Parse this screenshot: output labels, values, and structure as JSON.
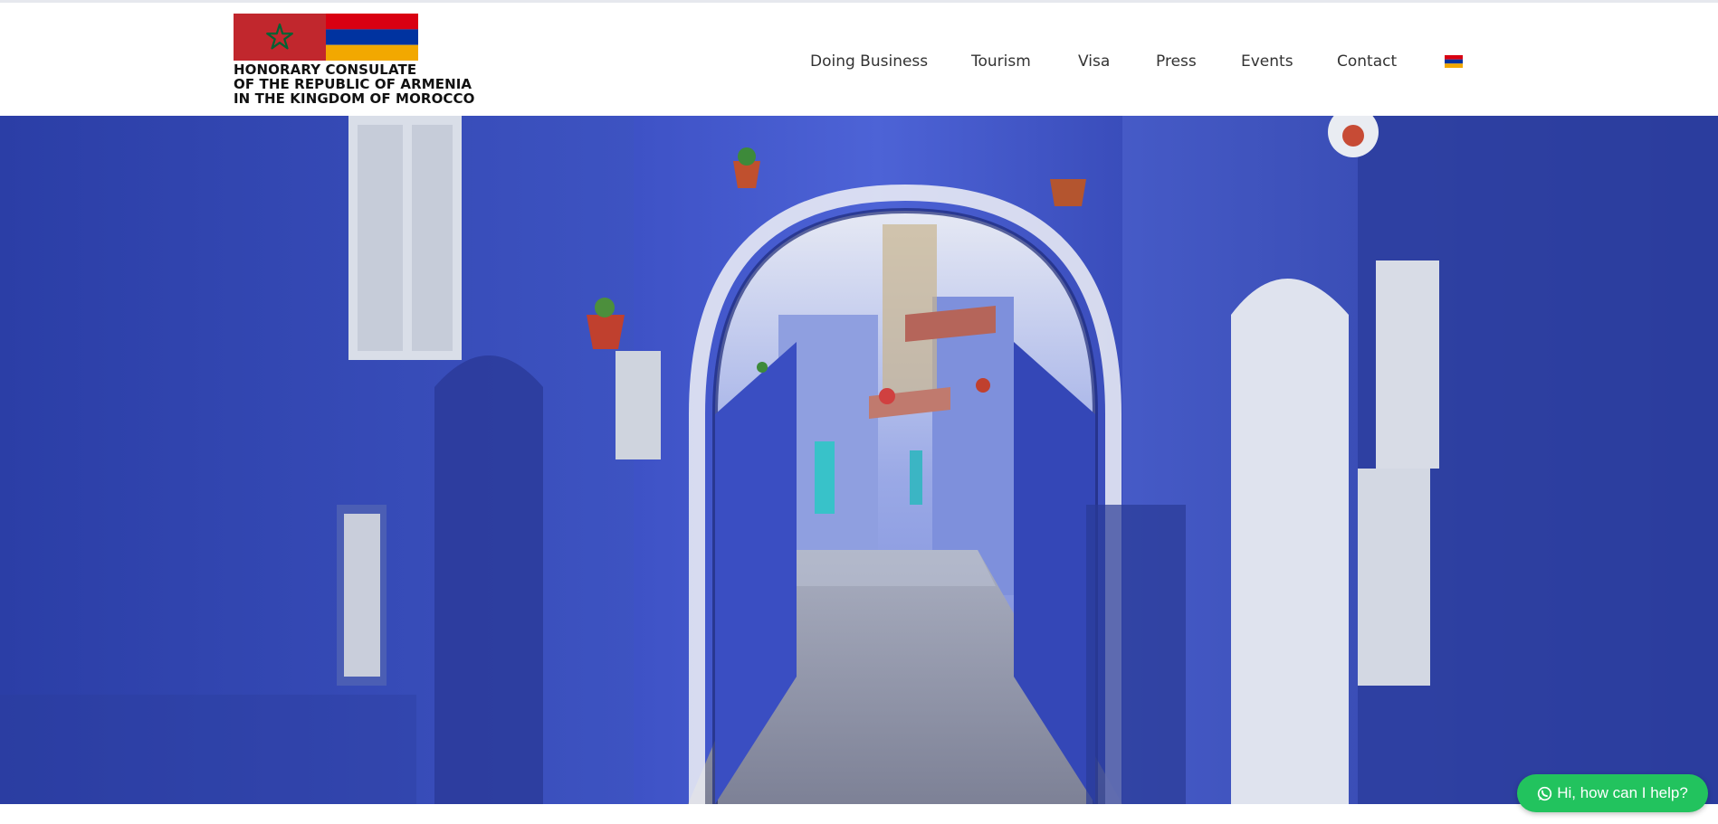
{
  "header": {
    "logo_lines": [
      "HONORARY CONSULATE",
      "OF THE REPUBLIC OF ARMENIA",
      "IN THE KINGDOM OF MOROCCO"
    ],
    "flags": {
      "morocco": {
        "field": "#c1272d",
        "star": "#006233"
      },
      "armenia": {
        "red": "#d90012",
        "blue": "#0033a0",
        "orange": "#f2a800"
      }
    }
  },
  "nav": {
    "items": [
      "Doing Business",
      "Tourism",
      "Visa",
      "Press",
      "Events",
      "Contact"
    ],
    "language_icon": "armenia-flag-icon"
  },
  "hero": {
    "image": "blue-medina-alley-arch-photo",
    "palette": {
      "wall": "#3346b3",
      "shadow": "#1f2a7a",
      "light": "#b9c6ef",
      "path": "#8d93a6"
    }
  },
  "chat": {
    "label": "Hi, how can I help?",
    "icon": "whatsapp-icon",
    "color": "#22c35e"
  }
}
